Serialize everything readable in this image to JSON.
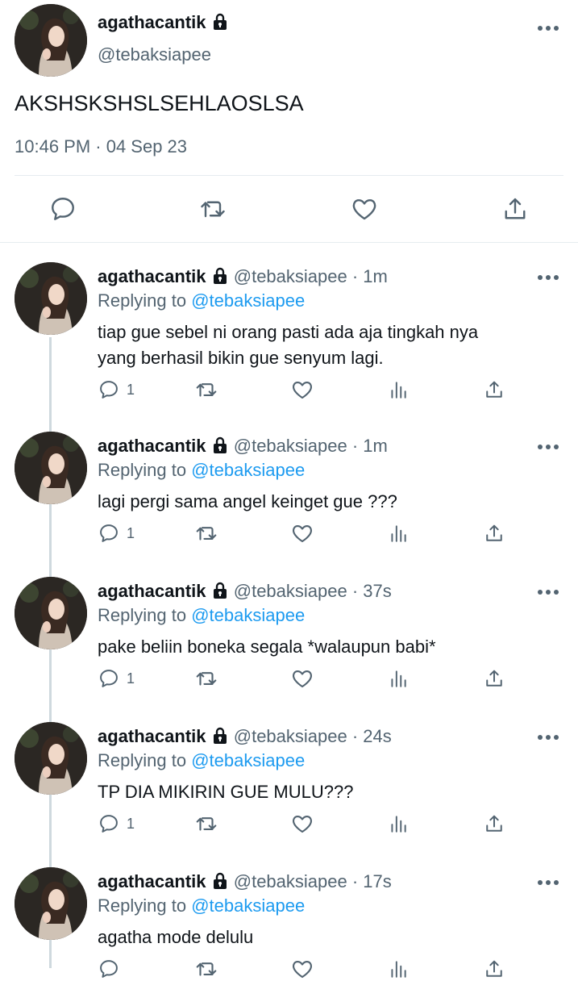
{
  "main_tweet": {
    "display_name": "agathacantik",
    "handle": "@tebaksiapee",
    "text": "AKSHSKSHSLSEHLAOSLSA",
    "timestamp": "10:46 PM · 04 Sep 23"
  },
  "replies": [
    {
      "display_name": "agathacantik",
      "handle": "@tebaksiapee",
      "time": "· 1m",
      "replying_prefix": "Replying to",
      "replying_to": "@tebaksiapee",
      "text_lines": [
        "tiap gue sebel ni orang pasti ada aja tingkah nya",
        "yang berhasil bikin gue senyum lagi."
      ],
      "reply_count": "1"
    },
    {
      "display_name": "agathacantik",
      "handle": "@tebaksiapee",
      "time": "· 1m",
      "replying_prefix": "Replying to",
      "replying_to": "@tebaksiapee",
      "text_lines": [
        "lagi pergi sama angel keinget gue ???"
      ],
      "reply_count": "1"
    },
    {
      "display_name": "agathacantik",
      "handle": "@tebaksiapee",
      "time": "· 37s",
      "replying_prefix": "Replying to",
      "replying_to": "@tebaksiapee",
      "text_lines": [
        "pake beliin boneka segala *walaupun babi*"
      ],
      "reply_count": "1"
    },
    {
      "display_name": "agathacantik",
      "handle": "@tebaksiapee",
      "time": "· 24s",
      "replying_prefix": "Replying to",
      "replying_to": "@tebaksiapee",
      "text_lines": [
        "TP DIA MIKIRIN GUE MULU???"
      ],
      "reply_count": "1"
    },
    {
      "display_name": "agathacantik",
      "handle": "@tebaksiapee",
      "time": "· 17s",
      "replying_prefix": "Replying to",
      "replying_to": "@tebaksiapee",
      "text_lines": [
        "agatha mode delulu"
      ],
      "reply_count": ""
    }
  ],
  "icons": {
    "lock": "lock-icon",
    "more": "more-icon",
    "reply": "reply-icon",
    "retweet": "retweet-icon",
    "like": "like-icon",
    "views": "views-icon",
    "share": "share-icon"
  },
  "colors": {
    "text": "#0f1419",
    "muted": "#536471",
    "link": "#1d9bf0",
    "thread_line": "#cfd9de"
  }
}
